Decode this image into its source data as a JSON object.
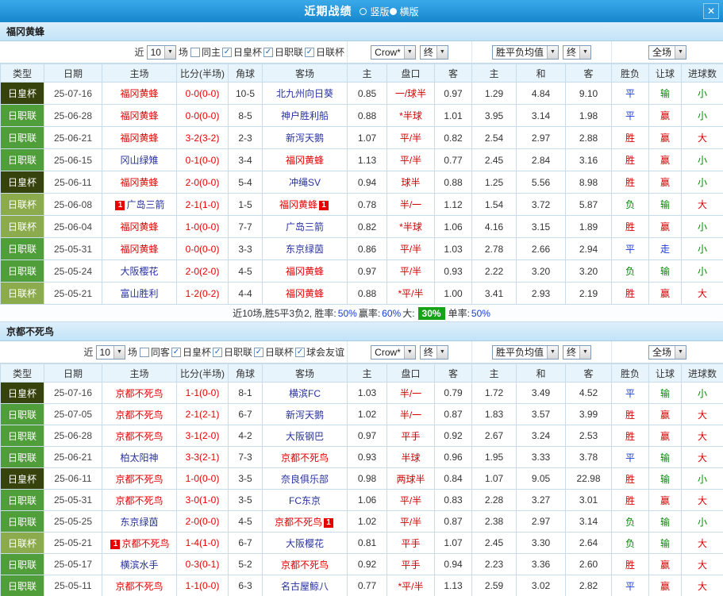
{
  "icons": {
    "dropdown_arrow": "▼",
    "check": "✓",
    "close": "✕"
  },
  "titlebar": {
    "title": "近期战绩",
    "radios": [
      {
        "label": "竖版",
        "selected": false
      },
      {
        "label": "横版",
        "selected": true
      }
    ]
  },
  "color_map": {
    "胜": "#d40000",
    "平": "#1a3cd4",
    "负": "#008a00",
    "赢": "#d40000",
    "输": "#008a00",
    "走": "#1a3cd4",
    "大": "#d40000",
    "小": "#008a00"
  },
  "league_colors": {
    "日皇杯": "#37430c",
    "日职联": "#4f9e3a",
    "日联杯": "#8cab4c"
  },
  "summary": {
    "segments": [
      {
        "text": "近10场,胜5平3负2, 胜率:",
        "style": "plain"
      },
      {
        "text": "50%",
        "style": "blue"
      },
      {
        "text": " 赢率:",
        "style": "plain"
      },
      {
        "text": "60%",
        "style": "blue"
      },
      {
        "text": " 大: ",
        "style": "plain"
      },
      {
        "text": "30%",
        "style": "green-badge"
      },
      {
        "text": " 单率:",
        "style": "plain"
      },
      {
        "text": "50%",
        "style": "blue"
      }
    ]
  },
  "sections": [
    {
      "team": "福冈黄蜂",
      "filters": {
        "near": "近",
        "count": "10",
        "games": "场",
        "checkboxes": [
          {
            "label": "同主",
            "checked": false
          },
          {
            "label": "日皇杯",
            "checked": true
          },
          {
            "label": "日职联",
            "checked": true
          },
          {
            "label": "日联杯",
            "checked": true
          }
        ],
        "company": "Crow*",
        "company_final": "终",
        "avg": "胜平负均值",
        "avg_final": "终",
        "scope": "全场"
      },
      "columns": [
        "类型",
        "日期",
        "主场",
        "比分(半场)",
        "角球",
        "客场",
        "主",
        "盘口",
        "客",
        "主",
        "和",
        "客",
        "胜负",
        "让球",
        "进球数"
      ],
      "rows": [
        {
          "league": "日皇杯",
          "date": "25-07-16",
          "home": "福冈黄蜂",
          "home_focal": true,
          "score": "0-0(0-0)",
          "corner": "10-5",
          "away": "北九州向日葵",
          "o1": "0.85",
          "hcp": "一/球半",
          "o2": "0.97",
          "a1": "1.29",
          "a2": "4.84",
          "a3": "9.10",
          "res": "平",
          "let": "输",
          "goal": "小"
        },
        {
          "league": "日职联",
          "date": "25-06-28",
          "home": "福冈黄蜂",
          "home_focal": true,
          "score": "0-0(0-0)",
          "corner": "8-5",
          "away": "神户胜利船",
          "o1": "0.88",
          "hcp": "*半球",
          "o2": "1.01",
          "a1": "3.95",
          "a2": "3.14",
          "a3": "1.98",
          "res": "平",
          "let": "赢",
          "goal": "小"
        },
        {
          "league": "日职联",
          "date": "25-06-21",
          "home": "福冈黄蜂",
          "home_focal": true,
          "score": "3-2(3-2)",
          "corner": "2-3",
          "away": "新泻天鹅",
          "o1": "1.07",
          "hcp": "平/半",
          "o2": "0.82",
          "a1": "2.54",
          "a2": "2.97",
          "a3": "2.88",
          "res": "胜",
          "let": "赢",
          "goal": "大"
        },
        {
          "league": "日职联",
          "date": "25-06-15",
          "home": "冈山绿雉",
          "score": "0-1(0-0)",
          "corner": "3-4",
          "away": "福冈黄蜂",
          "away_focal": true,
          "o1": "1.13",
          "hcp": "平/半",
          "o2": "0.77",
          "a1": "2.45",
          "a2": "2.84",
          "a3": "3.16",
          "res": "胜",
          "let": "赢",
          "goal": "小"
        },
        {
          "league": "日皇杯",
          "date": "25-06-11",
          "home": "福冈黄蜂",
          "home_focal": true,
          "score": "2-0(0-0)",
          "corner": "5-4",
          "away": "冲绳SV",
          "o1": "0.94",
          "hcp": "球半",
          "o2": "0.88",
          "a1": "1.25",
          "a2": "5.56",
          "a3": "8.98",
          "res": "胜",
          "let": "赢",
          "goal": "小"
        },
        {
          "league": "日联杯",
          "date": "25-06-08",
          "home": "广岛三箭",
          "home_badge": "1",
          "score": "2-1(1-0)",
          "corner": "1-5",
          "away": "福冈黄蜂",
          "away_focal": true,
          "away_badge": "1",
          "o1": "0.78",
          "hcp": "半/一",
          "o2": "1.12",
          "a1": "1.54",
          "a2": "3.72",
          "a3": "5.87",
          "res": "负",
          "let": "输",
          "goal": "大"
        },
        {
          "league": "日联杯",
          "date": "25-06-04",
          "home": "福冈黄蜂",
          "home_focal": true,
          "score": "1-0(0-0)",
          "corner": "7-7",
          "away": "广岛三箭",
          "o1": "0.82",
          "hcp": "*半球",
          "o2": "1.06",
          "a1": "4.16",
          "a2": "3.15",
          "a3": "1.89",
          "res": "胜",
          "let": "赢",
          "goal": "小"
        },
        {
          "league": "日职联",
          "date": "25-05-31",
          "home": "福冈黄蜂",
          "home_focal": true,
          "score": "0-0(0-0)",
          "corner": "3-3",
          "away": "东京绿茵",
          "o1": "0.86",
          "hcp": "平/半",
          "o2": "1.03",
          "a1": "2.78",
          "a2": "2.66",
          "a3": "2.94",
          "res": "平",
          "let": "走",
          "goal": "小"
        },
        {
          "league": "日职联",
          "date": "25-05-24",
          "home": "大阪樱花",
          "score": "2-0(2-0)",
          "corner": "4-5",
          "away": "福冈黄蜂",
          "away_focal": true,
          "o1": "0.97",
          "hcp": "平/半",
          "o2": "0.93",
          "a1": "2.22",
          "a2": "3.20",
          "a3": "3.20",
          "res": "负",
          "let": "输",
          "goal": "小"
        },
        {
          "league": "日联杯",
          "date": "25-05-21",
          "home": "富山胜利",
          "score": "1-2(0-2)",
          "corner": "4-4",
          "away": "福冈黄蜂",
          "away_focal": true,
          "o1": "0.88",
          "hcp": "*平/半",
          "o2": "1.00",
          "a1": "3.41",
          "a2": "2.93",
          "a3": "2.19",
          "res": "胜",
          "let": "赢",
          "goal": "大"
        }
      ]
    },
    {
      "team": "京都不死鸟",
      "filters": {
        "near": "近",
        "count": "10",
        "games": "场",
        "checkboxes": [
          {
            "label": "同客",
            "checked": false
          },
          {
            "label": "日皇杯",
            "checked": true
          },
          {
            "label": "日职联",
            "checked": true
          },
          {
            "label": "日联杯",
            "checked": true
          },
          {
            "label": "球会友谊",
            "checked": true
          }
        ],
        "company": "Crow*",
        "company_final": "终",
        "avg": "胜平负均值",
        "avg_final": "终",
        "scope": "全场"
      },
      "columns": [
        "类型",
        "日期",
        "主场",
        "比分(半场)",
        "角球",
        "客场",
        "主",
        "盘口",
        "客",
        "主",
        "和",
        "客",
        "胜负",
        "让球",
        "进球数"
      ],
      "rows": [
        {
          "league": "日皇杯",
          "date": "25-07-16",
          "home": "京都不死鸟",
          "home_focal": true,
          "score": "1-1(0-0)",
          "corner": "8-1",
          "away": "横滨FC",
          "o1": "1.03",
          "hcp": "半/一",
          "o2": "0.79",
          "a1": "1.72",
          "a2": "3.49",
          "a3": "4.52",
          "res": "平",
          "let": "输",
          "goal": "小"
        },
        {
          "league": "日职联",
          "date": "25-07-05",
          "home": "京都不死鸟",
          "home_focal": true,
          "score": "2-1(2-1)",
          "corner": "6-7",
          "away": "新泻天鹅",
          "o1": "1.02",
          "hcp": "半/一",
          "o2": "0.87",
          "a1": "1.83",
          "a2": "3.57",
          "a3": "3.99",
          "res": "胜",
          "let": "赢",
          "goal": "大"
        },
        {
          "league": "日职联",
          "date": "25-06-28",
          "home": "京都不死鸟",
          "home_focal": true,
          "score": "3-1(2-0)",
          "corner": "4-2",
          "away": "大阪钢巴",
          "o1": "0.97",
          "hcp": "平手",
          "o2": "0.92",
          "a1": "2.67",
          "a2": "3.24",
          "a3": "2.53",
          "res": "胜",
          "let": "赢",
          "goal": "大"
        },
        {
          "league": "日职联",
          "date": "25-06-21",
          "home": "柏太阳神",
          "score": "3-3(2-1)",
          "corner": "7-3",
          "away": "京都不死鸟",
          "away_focal": true,
          "o1": "0.93",
          "hcp": "半球",
          "o2": "0.96",
          "a1": "1.95",
          "a2": "3.33",
          "a3": "3.78",
          "res": "平",
          "let": "输",
          "goal": "大"
        },
        {
          "league": "日皇杯",
          "date": "25-06-11",
          "home": "京都不死鸟",
          "home_focal": true,
          "score": "1-0(0-0)",
          "corner": "3-5",
          "away": "奈良俱乐部",
          "o1": "0.98",
          "hcp": "两球半",
          "o2": "0.84",
          "a1": "1.07",
          "a2": "9.05",
          "a3": "22.98",
          "res": "胜",
          "let": "输",
          "goal": "小"
        },
        {
          "league": "日职联",
          "date": "25-05-31",
          "home": "京都不死鸟",
          "home_focal": true,
          "score": "3-0(1-0)",
          "corner": "3-5",
          "away": "FC东京",
          "o1": "1.06",
          "hcp": "平/半",
          "o2": "0.83",
          "a1": "2.28",
          "a2": "3.27",
          "a3": "3.01",
          "res": "胜",
          "let": "赢",
          "goal": "大"
        },
        {
          "league": "日职联",
          "date": "25-05-25",
          "home": "东京绿茵",
          "score": "2-0(0-0)",
          "corner": "4-5",
          "away": "京都不死鸟",
          "away_focal": true,
          "away_badge": "1",
          "o1": "1.02",
          "hcp": "平/半",
          "o2": "0.87",
          "a1": "2.38",
          "a2": "2.97",
          "a3": "3.14",
          "res": "负",
          "let": "输",
          "goal": "小"
        },
        {
          "league": "日联杯",
          "date": "25-05-21",
          "home": "京都不死鸟",
          "home_focal": true,
          "home_badge": "1",
          "score": "1-4(1-0)",
          "corner": "6-7",
          "away": "大阪樱花",
          "o1": "0.81",
          "hcp": "平手",
          "o2": "1.07",
          "a1": "2.45",
          "a2": "3.30",
          "a3": "2.64",
          "res": "负",
          "let": "输",
          "goal": "大"
        },
        {
          "league": "日职联",
          "date": "25-05-17",
          "home": "横滨水手",
          "score": "0-3(0-1)",
          "corner": "5-2",
          "away": "京都不死鸟",
          "away_focal": true,
          "o1": "0.92",
          "hcp": "平手",
          "o2": "0.94",
          "a1": "2.23",
          "a2": "3.36",
          "a3": "2.60",
          "res": "胜",
          "let": "赢",
          "goal": "大"
        },
        {
          "league": "日职联",
          "date": "25-05-11",
          "home": "京都不死鸟",
          "home_focal": true,
          "score": "1-1(0-0)",
          "corner": "6-3",
          "away": "名古屋鲸八",
          "o1": "0.77",
          "hcp": "*平/半",
          "o2": "1.13",
          "a1": "2.59",
          "a2": "3.02",
          "a3": "2.82",
          "res": "平",
          "let": "赢",
          "goal": "大"
        }
      ]
    }
  ]
}
